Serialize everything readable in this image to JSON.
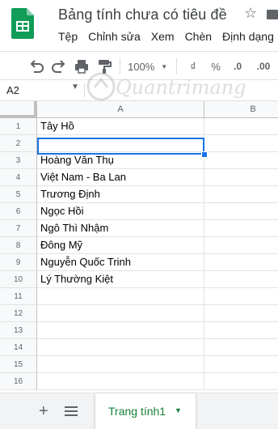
{
  "header": {
    "title": "Bảng tính chưa có tiêu đề",
    "menu": [
      "Tệp",
      "Chỉnh sửa",
      "Xem",
      "Chèn",
      "Định dạng"
    ]
  },
  "toolbar": {
    "zoom": "100%",
    "currency": "₫",
    "percent": "%",
    "decrease_decimal": ".0",
    "increase_decimal": ".00"
  },
  "formula_bar": {
    "name_box": "A2"
  },
  "watermark": "Quantrimang",
  "grid": {
    "columns": [
      "A",
      "B"
    ],
    "rows": [
      {
        "n": "1",
        "a": "Tây Hồ"
      },
      {
        "n": "2",
        "a": ""
      },
      {
        "n": "3",
        "a": "Hoàng Văn Thụ"
      },
      {
        "n": "4",
        "a": "Việt Nam - Ba Lan"
      },
      {
        "n": "5",
        "a": "Trương Định"
      },
      {
        "n": "6",
        "a": "Ngọc Hồi"
      },
      {
        "n": "7",
        "a": "Ngô Thì Nhậm"
      },
      {
        "n": "8",
        "a": "Đông Mỹ"
      },
      {
        "n": "9",
        "a": "Nguyễn Quốc Trinh"
      },
      {
        "n": "10",
        "a": "Lý Thường Kiệt"
      },
      {
        "n": "11",
        "a": ""
      },
      {
        "n": "12",
        "a": ""
      },
      {
        "n": "13",
        "a": ""
      },
      {
        "n": "14",
        "a": ""
      },
      {
        "n": "15",
        "a": ""
      },
      {
        "n": "16",
        "a": ""
      }
    ]
  },
  "sheets": {
    "active_tab": "Trang tính1"
  },
  "colors": {
    "sheets_green": "#0f9d58",
    "selection_blue": "#1a73e8",
    "tab_green": "#188038"
  }
}
